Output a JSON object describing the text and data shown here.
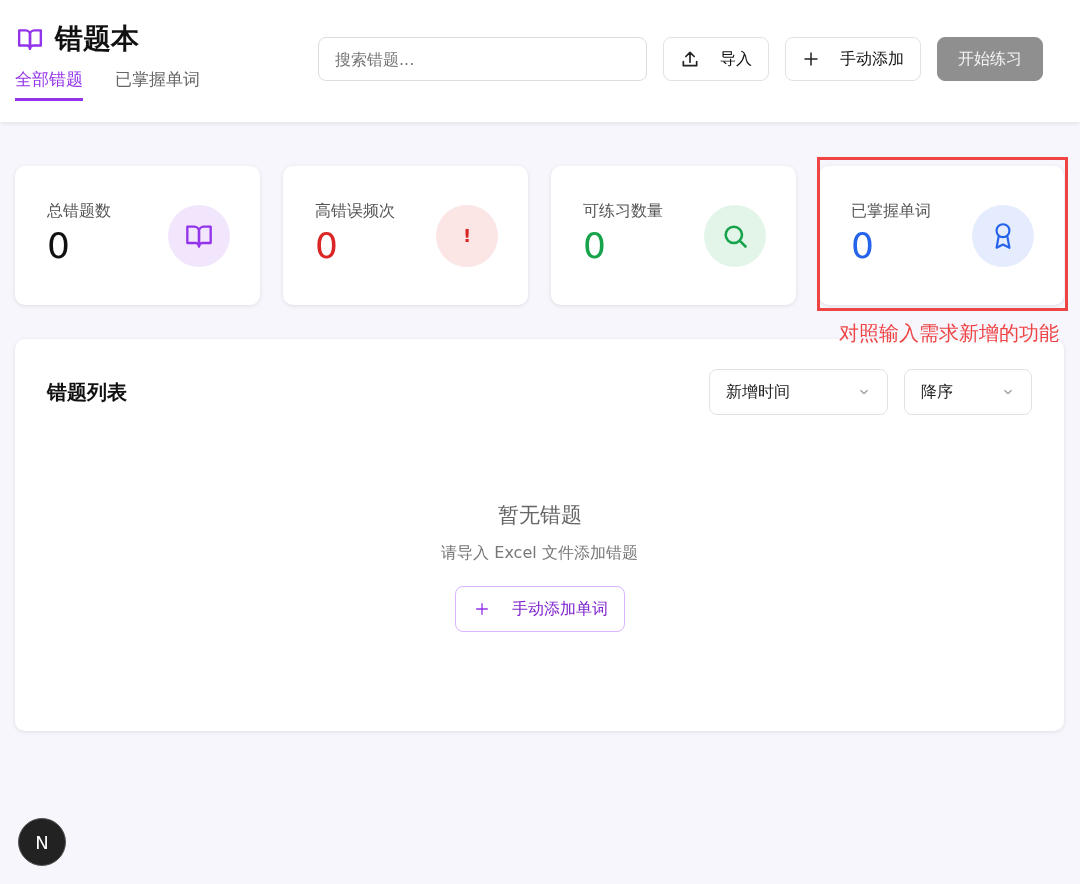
{
  "header": {
    "title": "错题本",
    "tabs": [
      {
        "label": "全部错题",
        "selected": true
      },
      {
        "label": "已掌握单词",
        "selected": false
      }
    ],
    "search": {
      "placeholder": "搜索错题..."
    },
    "buttons": [
      {
        "kind": "import",
        "label": "导入",
        "disabled": false
      },
      {
        "kind": "add",
        "label": "手动添加",
        "disabled": false
      },
      {
        "kind": "practice",
        "label": "开始练习",
        "disabled": true
      }
    ]
  },
  "stats": [
    {
      "label": "总错题数",
      "value": "0",
      "kind": "book",
      "color": "#9333ea",
      "highlighted": false
    },
    {
      "label": "高错误频次",
      "value": "0",
      "kind": "alert",
      "icon_text": "!",
      "color": "#dc2626",
      "highlighted": false
    },
    {
      "label": "可练习数量",
      "value": "0",
      "kind": "search",
      "color": "#16a34a",
      "highlighted": false
    },
    {
      "label": "已掌握单词",
      "value": "0",
      "kind": "award",
      "color": "#2563eb",
      "highlighted": true
    }
  ],
  "annotation": "对照输入需求新增的功能",
  "list": {
    "title": "错题列表",
    "selects": [
      {
        "value": "新增时间"
      },
      {
        "value": "降序"
      }
    ],
    "empty": {
      "title": "暂无错题",
      "message": "请导入 Excel 文件添加错题",
      "button": "手动添加单词"
    }
  },
  "badge": "N"
}
